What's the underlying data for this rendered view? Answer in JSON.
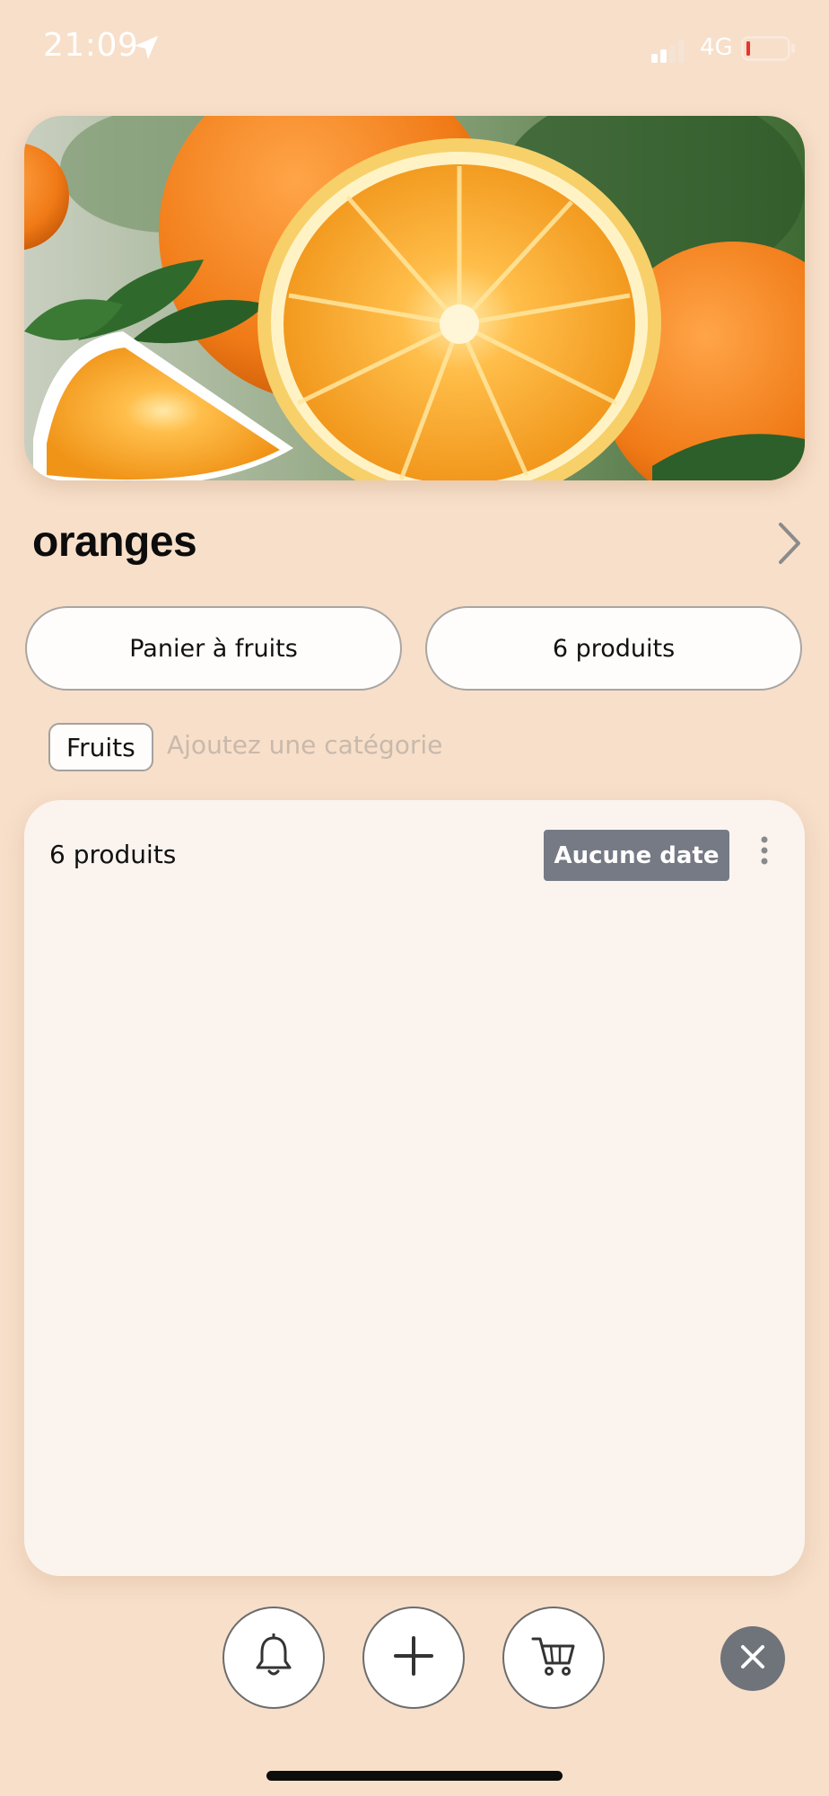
{
  "status_bar": {
    "time": "21:09",
    "network": "4G",
    "icons": [
      "location-arrow-icon",
      "signal-bars-icon",
      "battery-low-icon"
    ]
  },
  "hero_image": {
    "subject": "oranges-photo"
  },
  "list": {
    "title": "oranges",
    "basket_label": "Panier à fruits",
    "products_label": "6 produits"
  },
  "category": {
    "chip_label": "Fruits",
    "placeholder": "Ajoutez une catégorie"
  },
  "card": {
    "count_label": "6 produits",
    "date_badge": "Aucune date"
  },
  "toolbar": {
    "buttons": [
      "bell-icon",
      "plus-icon",
      "cart-icon",
      "close-icon"
    ]
  },
  "colors": {
    "background": "#f7dfca",
    "card": "#fbf4ee",
    "badge": "#757a85",
    "close_button": "#6f737a",
    "battery_low": "#e5352f"
  }
}
